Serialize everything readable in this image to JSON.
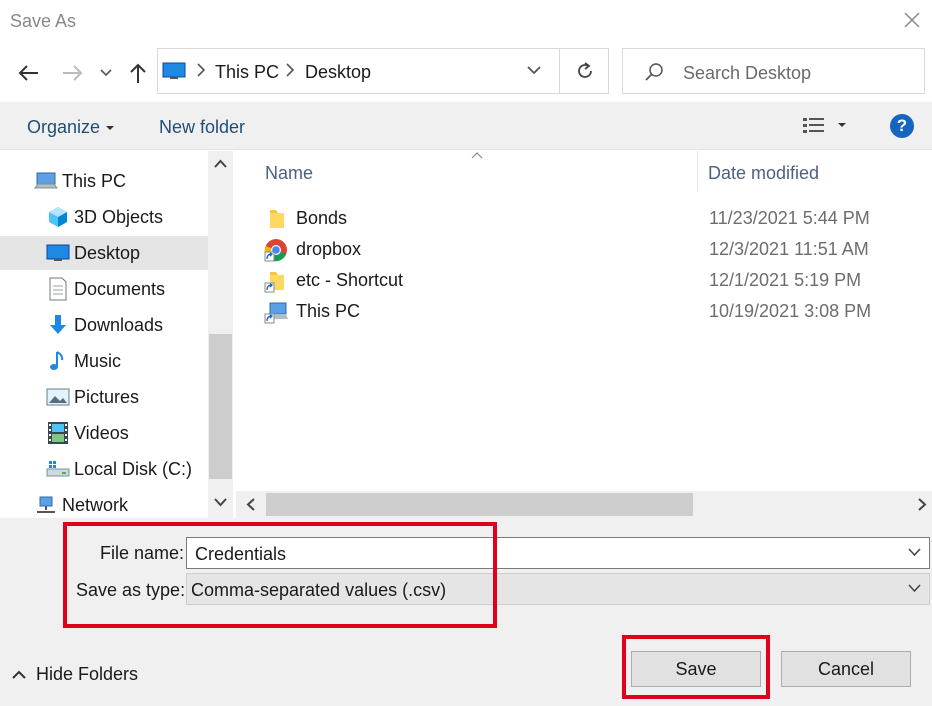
{
  "window": {
    "title": "Save As"
  },
  "nav": {
    "breadcrumbs": [
      "This PC",
      "Desktop"
    ],
    "search_placeholder": "Search Desktop"
  },
  "toolbar": {
    "organize": "Organize",
    "new_folder": "New folder",
    "help": "?"
  },
  "sidebar": {
    "items": [
      {
        "label": "This PC",
        "icon": "computer-icon"
      },
      {
        "label": "3D Objects",
        "icon": "cube-icon"
      },
      {
        "label": "Desktop",
        "icon": "desktop-icon",
        "selected": true
      },
      {
        "label": "Documents",
        "icon": "document-icon"
      },
      {
        "label": "Downloads",
        "icon": "download-arrow-icon"
      },
      {
        "label": "Music",
        "icon": "music-note-icon"
      },
      {
        "label": "Pictures",
        "icon": "picture-icon"
      },
      {
        "label": "Videos",
        "icon": "film-icon"
      },
      {
        "label": "Local Disk (C:)",
        "icon": "drive-icon"
      },
      {
        "label": "Network",
        "icon": "network-icon"
      }
    ]
  },
  "files": {
    "columns": {
      "name": "Name",
      "date": "Date modified"
    },
    "rows": [
      {
        "name": "Bonds",
        "date": "11/23/2021 5:44 PM",
        "icon": "folder-icon"
      },
      {
        "name": "dropbox",
        "date": "12/3/2021 11:51 AM",
        "icon": "chrome-shortcut-icon"
      },
      {
        "name": "etc - Shortcut",
        "date": "12/1/2021 5:19 PM",
        "icon": "folder-shortcut-icon"
      },
      {
        "name": "This PC",
        "date": "10/19/2021 3:08 PM",
        "icon": "computer-shortcut-icon"
      }
    ]
  },
  "form": {
    "file_name_label": "File name:",
    "file_name_value": "Credentials",
    "save_type_label": "Save as type:",
    "save_type_value": "Comma-separated values (.csv)"
  },
  "footer": {
    "hide_folders": "Hide Folders",
    "save": "Save",
    "cancel": "Cancel"
  },
  "colors": {
    "highlight": "#e0001b",
    "accent": "#1565c0",
    "selected_bg": "#e5e5e5"
  }
}
